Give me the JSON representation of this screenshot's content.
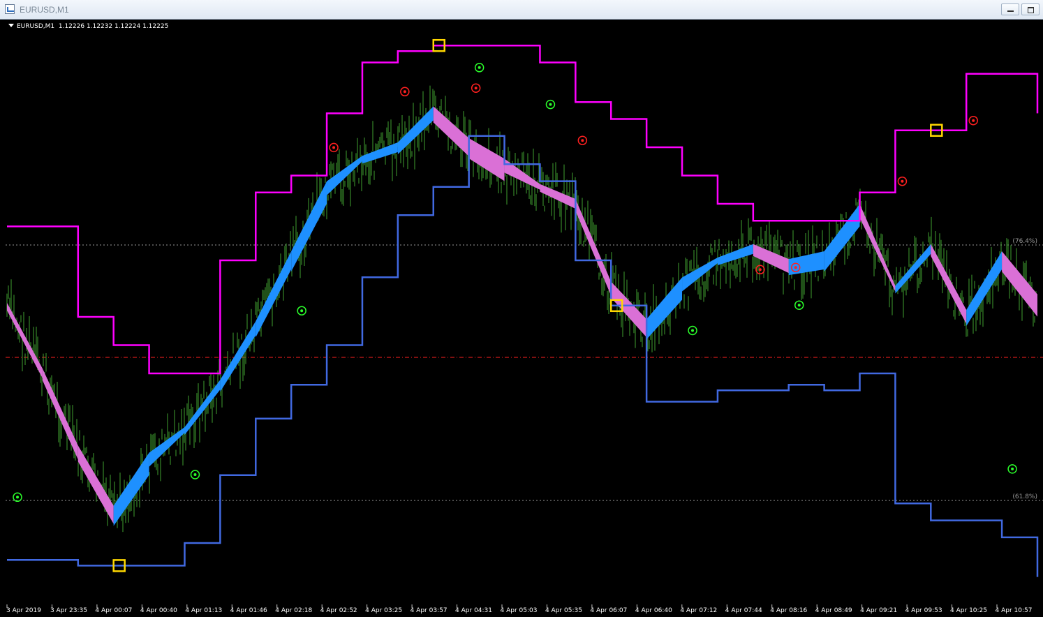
{
  "window": {
    "title": "EURUSD,M1"
  },
  "chart_header": {
    "symbol": "EURUSD,M1",
    "prices": "1.12226 1.12232 1.12224 1.12225"
  },
  "colors": {
    "background": "#000000",
    "upper_channel": "#ff00ff",
    "lower_channel": "#4169e1",
    "bull_ribbon": "#1e90ff",
    "bear_ribbon": "#da70d6",
    "price_bars": "#3f9f2f",
    "fib_lines": "#9a9a9a",
    "mid_line": "#ff2020",
    "sell_dot": "#ff2020",
    "buy_dot": "#2bff2b",
    "square_marker": "#ffd700"
  },
  "fib_levels": [
    "(76.4%)",
    "(61.8%)"
  ],
  "chart_data": {
    "type": "line",
    "title": "EURUSD,M1",
    "x_tick_labels": [
      "3 Apr 2019",
      "3 Apr 23:35",
      "4 Apr 00:07",
      "4 Apr 00:40",
      "4 Apr 01:13",
      "4 Apr 01:46",
      "4 Apr 02:18",
      "4 Apr 02:52",
      "4 Apr 03:25",
      "4 Apr 03:57",
      "4 Apr 04:31",
      "4 Apr 05:03",
      "4 Apr 05:35",
      "4 Apr 06:07",
      "4 Apr 06:40",
      "4 Apr 07:12",
      "4 Apr 07:44",
      "4 Apr 08:16",
      "4 Apr 08:49",
      "4 Apr 09:21",
      "4 Apr 09:53",
      "4 Apr 10:25",
      "4 Apr 10:57"
    ],
    "y_range_relative": [
      0,
      100
    ],
    "series": [
      {
        "name": "upper",
        "values": [
          66,
          66,
          50,
          45,
          40,
          40,
          60,
          72,
          75,
          86,
          95,
          97,
          98,
          98,
          98,
          95,
          88,
          85,
          80,
          75,
          70,
          67,
          67,
          67,
          72,
          83,
          83,
          93,
          93,
          86
        ]
      },
      {
        "name": "lower",
        "values": [
          7,
          7,
          6,
          6,
          6,
          10,
          22,
          32,
          38,
          45,
          57,
          68,
          73,
          82,
          77,
          74,
          60,
          52,
          35,
          35,
          37,
          37,
          38,
          37,
          40,
          17,
          14,
          14,
          11,
          4
        ]
      },
      {
        "name": "ribbon",
        "values": [
          52,
          40,
          26,
          15,
          24,
          30,
          38,
          48,
          60,
          72,
          78,
          80,
          86,
          80,
          76,
          73,
          70,
          55,
          48,
          55,
          60,
          62,
          59,
          60,
          68,
          55,
          62,
          50,
          60,
          52
        ]
      }
    ]
  }
}
